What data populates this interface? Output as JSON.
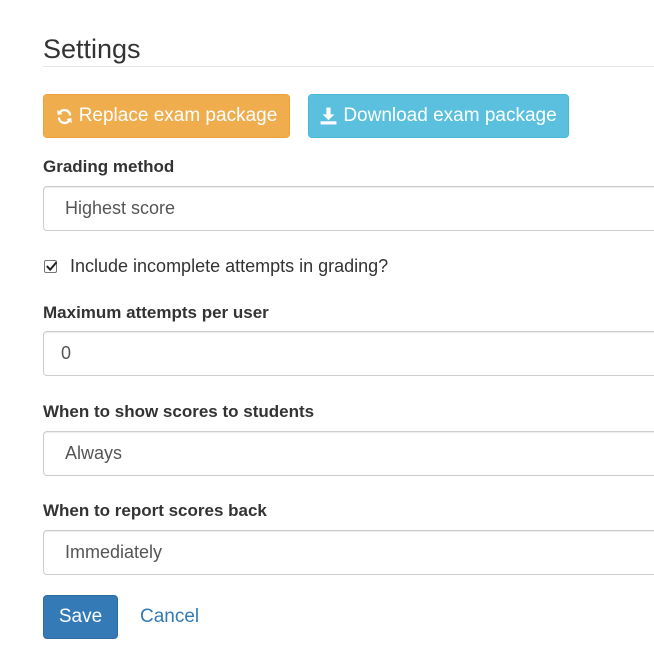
{
  "header": {
    "title": "Settings"
  },
  "actions": {
    "replace_label": "Replace exam package",
    "replace_icon": "refresh-icon",
    "download_label": "Download exam package",
    "download_icon": "download-icon"
  },
  "form": {
    "grading_method": {
      "label": "Grading method",
      "value": "Highest score"
    },
    "include_incomplete": {
      "label": "Include incomplete attempts in grading?",
      "checked": true
    },
    "max_attempts": {
      "label": "Maximum attempts per user",
      "value": "0"
    },
    "show_scores": {
      "label": "When to show scores to students",
      "value": "Always"
    },
    "report_scores": {
      "label": "When to report scores back",
      "value": "Immediately"
    }
  },
  "footer": {
    "save_label": "Save",
    "cancel_label": "Cancel"
  },
  "colors": {
    "warning": "#f0ad4e",
    "info": "#5bc0de",
    "primary": "#337ab7",
    "link": "#337ab7"
  }
}
